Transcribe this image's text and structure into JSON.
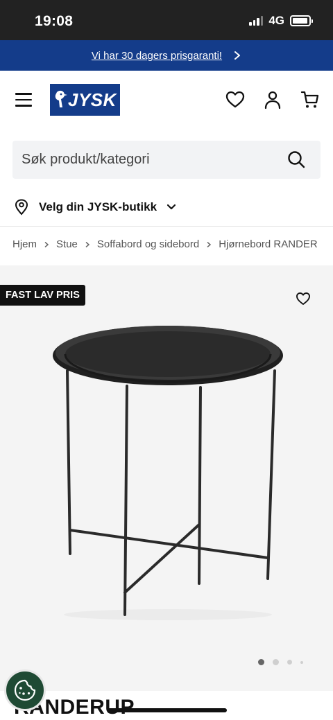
{
  "status_bar": {
    "time": "19:08",
    "network": "4G",
    "battery_level": 0.95
  },
  "promo": {
    "text": "Vi har 30 dagers prisgaranti!",
    "icon": "chevron-right-icon"
  },
  "header": {
    "logo_text": "JYSK",
    "icons": [
      "menu-icon",
      "heart-icon",
      "user-icon",
      "cart-icon"
    ]
  },
  "search": {
    "placeholder": "Søk produkt/kategori",
    "icon": "search-icon"
  },
  "store_selector": {
    "label": "Velg din JYSK-butikk",
    "icons": [
      "location-pin-icon",
      "chevron-down-icon"
    ]
  },
  "breadcrumb": {
    "items": [
      "Hjem",
      "Stue",
      "Soffabord og sidebord",
      "Hjørnebord RANDER"
    ]
  },
  "product": {
    "badge": "FAST LAV PRIS",
    "title": "RANDERUP",
    "image_alt_icon": "side-table-image",
    "carousel": {
      "total": 4,
      "active_index": 0
    }
  },
  "cookie": {
    "icon": "cookie-icon"
  },
  "colors": {
    "brand_blue": "#143c8a",
    "status_bar": "#222222",
    "cookie_green": "#1f4a34"
  }
}
